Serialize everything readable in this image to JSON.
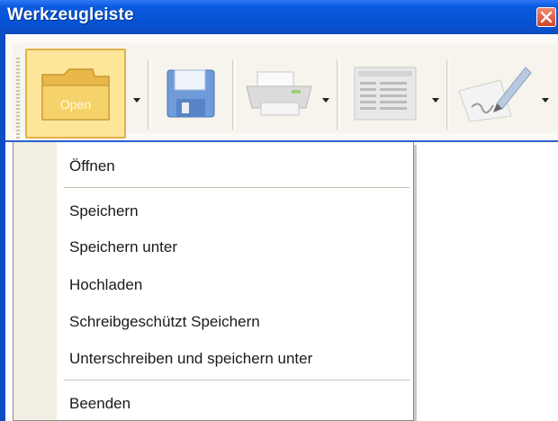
{
  "window": {
    "title": "Werkzeugleiste",
    "close_icon": "close-icon"
  },
  "toolbar": {
    "tools": [
      {
        "name": "open",
        "icon": "folder-open-icon",
        "icon_label": "Open",
        "has_dropdown": true
      },
      {
        "name": "save",
        "icon": "floppy-disk-icon",
        "has_dropdown": false
      },
      {
        "name": "print",
        "icon": "printer-icon",
        "has_dropdown": true
      },
      {
        "name": "export",
        "icon": "document-list-icon",
        "has_dropdown": true
      },
      {
        "name": "sign",
        "icon": "signature-pen-icon",
        "has_dropdown": true
      }
    ]
  },
  "menu": {
    "items": [
      {
        "label": "Öffnen"
      },
      {
        "label": "Speichern"
      },
      {
        "label": "Speichern unter"
      },
      {
        "label": "Hochladen"
      },
      {
        "label": "Schreibgeschützt Speichern"
      },
      {
        "label": "Unterschreiben und speichern unter"
      },
      {
        "label": "Beenden"
      }
    ]
  },
  "colors": {
    "titlebar": "#0a5ae0",
    "open_button_bg": "#fde69a",
    "menu_gutter": "#f1efe2"
  }
}
